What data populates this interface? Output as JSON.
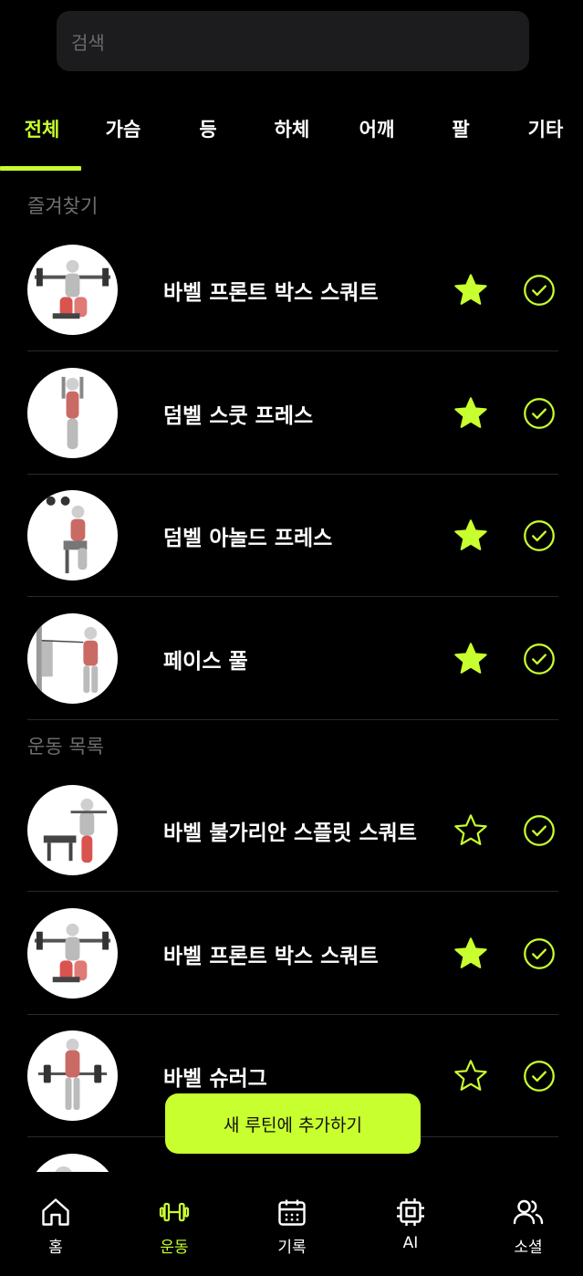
{
  "search": {
    "placeholder": "검색"
  },
  "tabs": [
    {
      "label": "전체",
      "active": true
    },
    {
      "label": "가슴"
    },
    {
      "label": "등"
    },
    {
      "label": "하체"
    },
    {
      "label": "어깨"
    },
    {
      "label": "팔"
    },
    {
      "label": "기타"
    }
  ],
  "favorites": {
    "title": "즐겨찾기",
    "items": [
      {
        "name": "바벨 프론트 박스 스쿼트",
        "favorite": true
      },
      {
        "name": "덤벨 스쿳 프레스",
        "favorite": true
      },
      {
        "name": "덤벨 아놀드 프레스",
        "favorite": true
      },
      {
        "name": "페이스 풀",
        "favorite": true
      }
    ]
  },
  "exercises": {
    "title": "운동 목록",
    "items": [
      {
        "name": "바벨 불가리안 스플릿 스쿼트",
        "favorite": false
      },
      {
        "name": "바벨 프론트 박스 스쿼트",
        "favorite": true
      },
      {
        "name": "바벨 슈러그",
        "favorite": false
      }
    ]
  },
  "cta": {
    "label": "새 루틴에 추가하기"
  },
  "nav": [
    {
      "label": "홈",
      "icon": "home-icon"
    },
    {
      "label": "운동",
      "icon": "dumbbell-icon",
      "active": true
    },
    {
      "label": "기록",
      "icon": "calendar-icon"
    },
    {
      "label": "AI",
      "icon": "chip-icon"
    },
    {
      "label": "소셜",
      "icon": "users-icon"
    }
  ],
  "colors": {
    "accent": "#c8ff2e",
    "background": "#000000",
    "muted": "#6f6f6f"
  }
}
